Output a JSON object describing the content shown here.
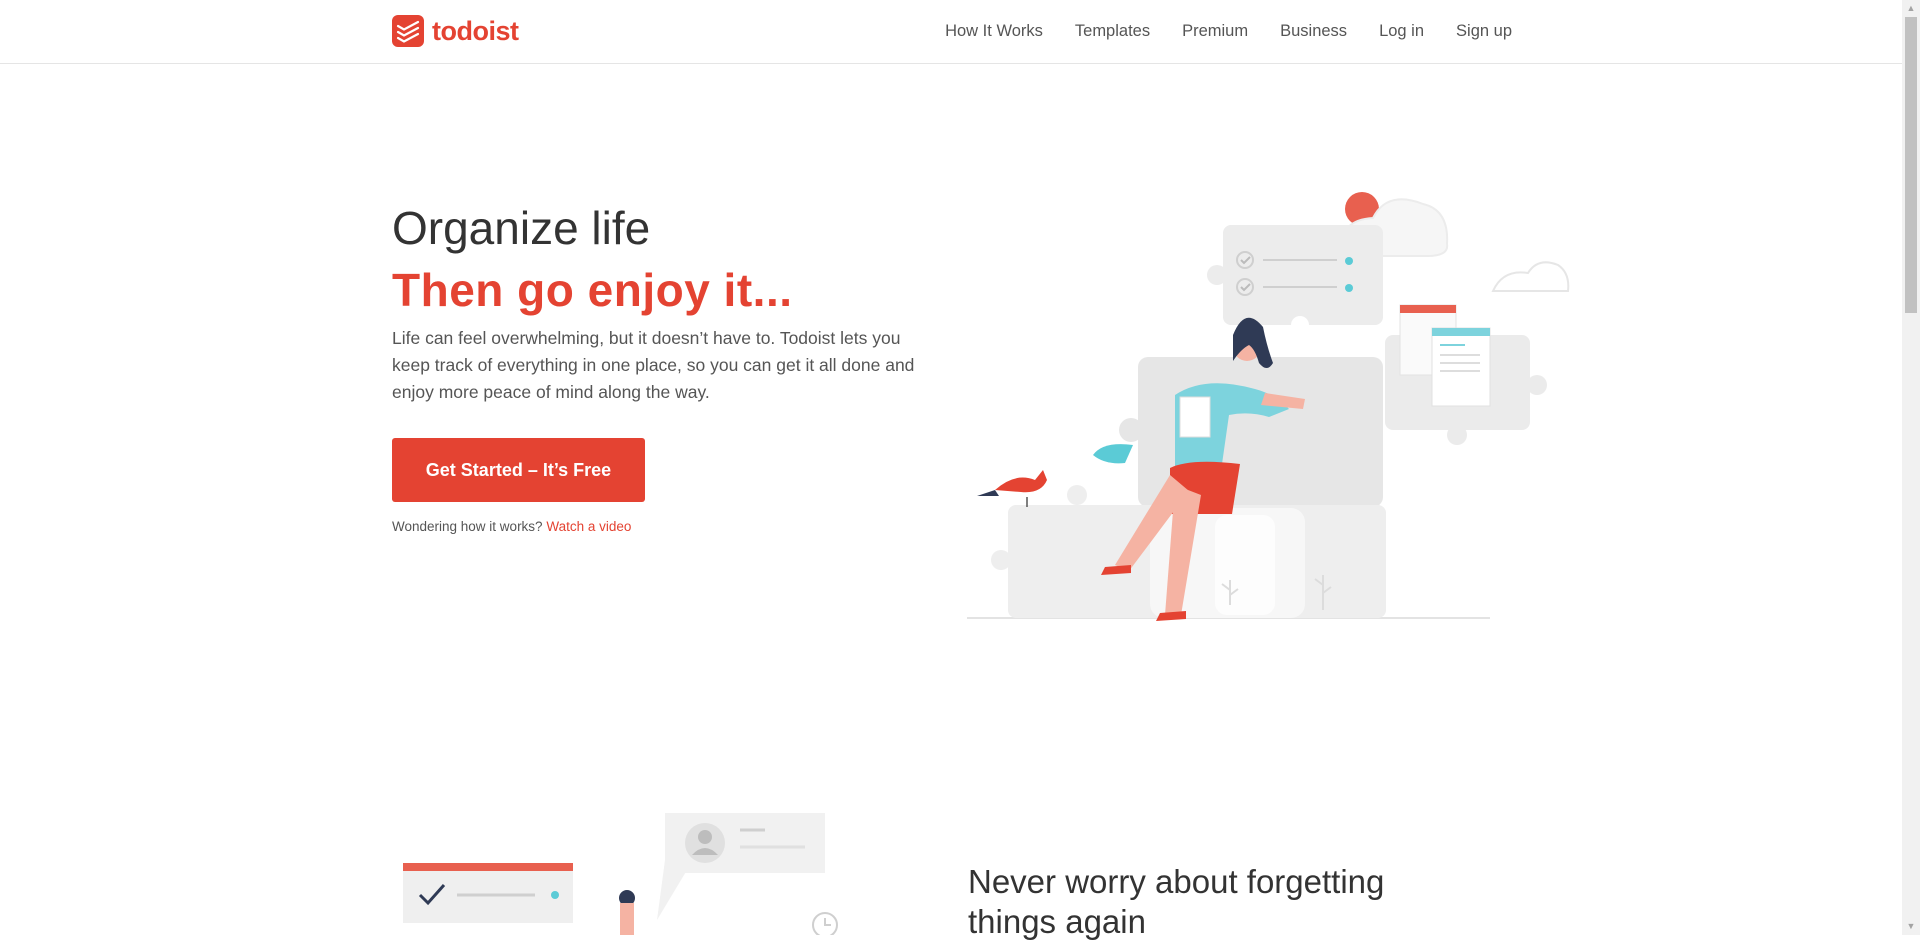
{
  "brand": {
    "name": "todoist",
    "color": "#e44332"
  },
  "nav": {
    "items": [
      "How It Works",
      "Templates",
      "Premium",
      "Business",
      "Log in",
      "Sign up"
    ]
  },
  "hero": {
    "title": "Organize life",
    "subtitle": "Then go enjoy it...",
    "description": "Life can feel overwhelming, but it doesn’t have to. Todoist lets you keep track of everything in one place, so you can get it all done and enjoy more peace of mind along the way.",
    "cta_label": "Get Started – It’s Free",
    "video_prompt": "Wondering how it works?",
    "video_link": "Watch a video"
  },
  "section2": {
    "title": "Never worry about forgetting things again"
  },
  "icons": {
    "logo": "todoist-logo-icon",
    "scroll_up": "scroll-up-arrow-icon",
    "scroll_down": "scroll-down-arrow-icon"
  }
}
